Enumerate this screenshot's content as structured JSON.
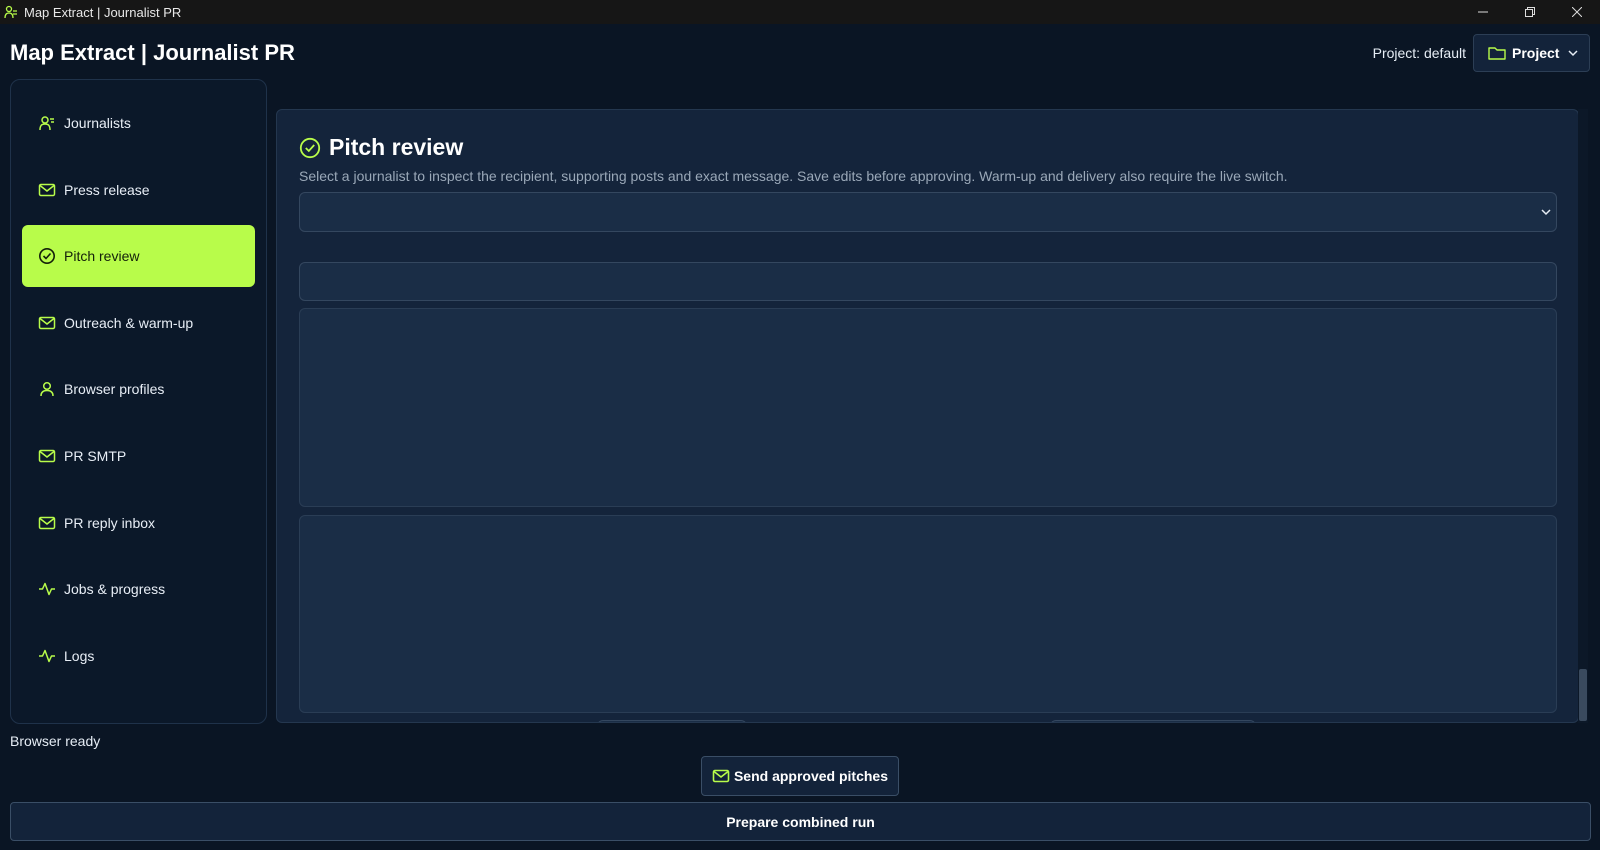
{
  "window": {
    "title": "Map Extract | Journalist PR",
    "controls": [
      "minimize-icon",
      "restore-icon",
      "close-icon"
    ]
  },
  "header": {
    "title": "Map Extract | Journalist PR",
    "project_label": "Project: default",
    "project_button": "Project"
  },
  "sidebar": {
    "items": [
      {
        "label": "Journalists",
        "icon": "journalists-icon",
        "active": false
      },
      {
        "label": "Press release",
        "icon": "mail-icon",
        "active": false
      },
      {
        "label": "Pitch review",
        "icon": "check-circle-icon",
        "active": true
      },
      {
        "label": "Outreach & warm-up",
        "icon": "mail-check-icon",
        "active": false
      },
      {
        "label": "Browser profiles",
        "icon": "user-icon",
        "active": false
      },
      {
        "label": "PR SMTP",
        "icon": "mail-icon",
        "active": false
      },
      {
        "label": "PR reply inbox",
        "icon": "mail-icon",
        "active": false
      },
      {
        "label": "Jobs & progress",
        "icon": "activity-icon",
        "active": false
      },
      {
        "label": "Logs",
        "icon": "activity-icon",
        "active": false
      }
    ]
  },
  "status": {
    "text": "Browser ready"
  },
  "main": {
    "title": "Pitch review",
    "description": "Select a journalist to inspect the recipient, supporting posts and exact message. Save edits before approving. Warm-up and delivery also require the live switch.",
    "journalist_select": {
      "value": ""
    },
    "subject": {
      "value": ""
    },
    "context": {
      "value": ""
    },
    "message": {
      "value": ""
    }
  },
  "footer": {
    "send_button": "Send approved pitches",
    "prepare_button": "Prepare combined run"
  },
  "colors": {
    "accent": "#b8fc4a",
    "background": "#0a1524",
    "panel": "#14243b"
  }
}
